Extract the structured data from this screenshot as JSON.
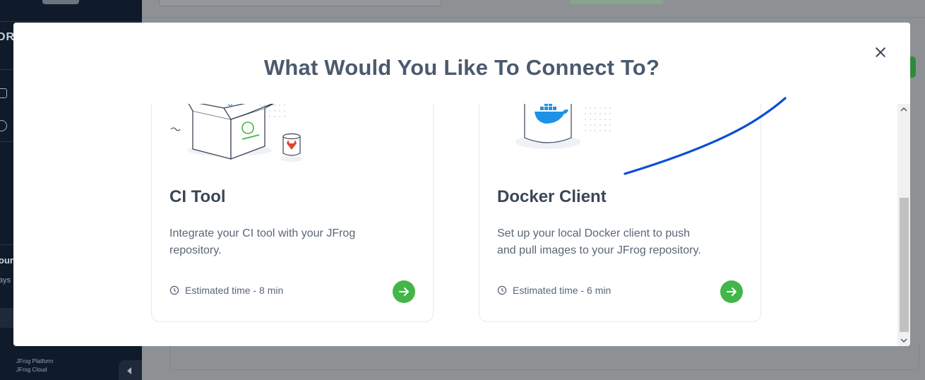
{
  "background": {
    "sidebar_fragment_1": "our",
    "sidebar_fragment_2": "ays",
    "sidebar_letters": "DR",
    "platform_line_1": "JFrog Platform",
    "platform_line_2": "JFrog Cloud"
  },
  "modal": {
    "title": "What Would You Like To Connect To?",
    "close_icon": "close-icon",
    "cards": [
      {
        "title": "CI Tool",
        "description": "Integrate your CI tool with your JFrog repository.",
        "time": "Estimated time - 8 min",
        "illustration": "ci-box-gitlab-illustration"
      },
      {
        "title": "Docker Client",
        "description": "Set up your local Docker client to push and pull images to your JFrog repository.",
        "time": "Estimated time - 6 min",
        "illustration": "docker-whale-illustration"
      }
    ]
  },
  "colors": {
    "accent_green": "#43b649",
    "title_text": "#4b5a6e",
    "annotation_blue": "#0b4fd6",
    "overlay": "#8e9194"
  }
}
